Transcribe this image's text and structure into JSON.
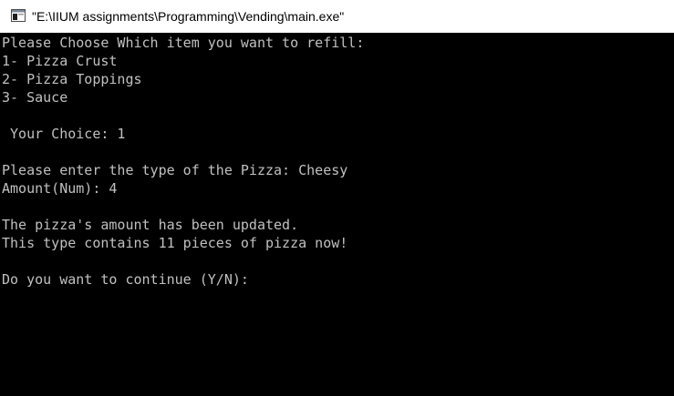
{
  "window": {
    "title": "\"E:\\IIUM assignments\\Programming\\Vending\\main.exe\"",
    "icon": "console-app-icon"
  },
  "console": {
    "lines": [
      "Please Choose Which item you want to refill:",
      "1- Pizza Crust",
      "2- Pizza Toppings",
      "3- Sauce",
      "",
      " Your Choice: 1",
      "",
      "Please enter the type of the Pizza: Cheesy",
      "Amount(Num): 4",
      "",
      "The pizza's amount has been updated.",
      "This type contains 11 pieces of pizza now!",
      "",
      "Do you want to continue (Y/N):"
    ],
    "text_color": "#c0c0c0",
    "background_color": "#000000"
  }
}
